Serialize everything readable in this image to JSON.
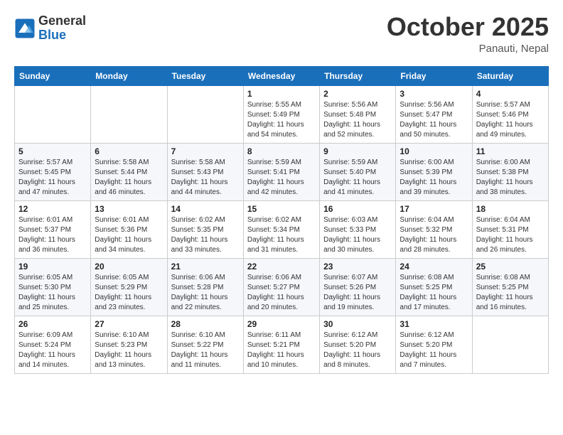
{
  "header": {
    "logo_general": "General",
    "logo_blue": "Blue",
    "title": "October 2025",
    "subtitle": "Panauti, Nepal"
  },
  "weekdays": [
    "Sunday",
    "Monday",
    "Tuesday",
    "Wednesday",
    "Thursday",
    "Friday",
    "Saturday"
  ],
  "weeks": [
    [
      {
        "day": "",
        "info": ""
      },
      {
        "day": "",
        "info": ""
      },
      {
        "day": "",
        "info": ""
      },
      {
        "day": "1",
        "info": "Sunrise: 5:55 AM\nSunset: 5:49 PM\nDaylight: 11 hours\nand 54 minutes."
      },
      {
        "day": "2",
        "info": "Sunrise: 5:56 AM\nSunset: 5:48 PM\nDaylight: 11 hours\nand 52 minutes."
      },
      {
        "day": "3",
        "info": "Sunrise: 5:56 AM\nSunset: 5:47 PM\nDaylight: 11 hours\nand 50 minutes."
      },
      {
        "day": "4",
        "info": "Sunrise: 5:57 AM\nSunset: 5:46 PM\nDaylight: 11 hours\nand 49 minutes."
      }
    ],
    [
      {
        "day": "5",
        "info": "Sunrise: 5:57 AM\nSunset: 5:45 PM\nDaylight: 11 hours\nand 47 minutes."
      },
      {
        "day": "6",
        "info": "Sunrise: 5:58 AM\nSunset: 5:44 PM\nDaylight: 11 hours\nand 46 minutes."
      },
      {
        "day": "7",
        "info": "Sunrise: 5:58 AM\nSunset: 5:43 PM\nDaylight: 11 hours\nand 44 minutes."
      },
      {
        "day": "8",
        "info": "Sunrise: 5:59 AM\nSunset: 5:41 PM\nDaylight: 11 hours\nand 42 minutes."
      },
      {
        "day": "9",
        "info": "Sunrise: 5:59 AM\nSunset: 5:40 PM\nDaylight: 11 hours\nand 41 minutes."
      },
      {
        "day": "10",
        "info": "Sunrise: 6:00 AM\nSunset: 5:39 PM\nDaylight: 11 hours\nand 39 minutes."
      },
      {
        "day": "11",
        "info": "Sunrise: 6:00 AM\nSunset: 5:38 PM\nDaylight: 11 hours\nand 38 minutes."
      }
    ],
    [
      {
        "day": "12",
        "info": "Sunrise: 6:01 AM\nSunset: 5:37 PM\nDaylight: 11 hours\nand 36 minutes."
      },
      {
        "day": "13",
        "info": "Sunrise: 6:01 AM\nSunset: 5:36 PM\nDaylight: 11 hours\nand 34 minutes."
      },
      {
        "day": "14",
        "info": "Sunrise: 6:02 AM\nSunset: 5:35 PM\nDaylight: 11 hours\nand 33 minutes."
      },
      {
        "day": "15",
        "info": "Sunrise: 6:02 AM\nSunset: 5:34 PM\nDaylight: 11 hours\nand 31 minutes."
      },
      {
        "day": "16",
        "info": "Sunrise: 6:03 AM\nSunset: 5:33 PM\nDaylight: 11 hours\nand 30 minutes."
      },
      {
        "day": "17",
        "info": "Sunrise: 6:04 AM\nSunset: 5:32 PM\nDaylight: 11 hours\nand 28 minutes."
      },
      {
        "day": "18",
        "info": "Sunrise: 6:04 AM\nSunset: 5:31 PM\nDaylight: 11 hours\nand 26 minutes."
      }
    ],
    [
      {
        "day": "19",
        "info": "Sunrise: 6:05 AM\nSunset: 5:30 PM\nDaylight: 11 hours\nand 25 minutes."
      },
      {
        "day": "20",
        "info": "Sunrise: 6:05 AM\nSunset: 5:29 PM\nDaylight: 11 hours\nand 23 minutes."
      },
      {
        "day": "21",
        "info": "Sunrise: 6:06 AM\nSunset: 5:28 PM\nDaylight: 11 hours\nand 22 minutes."
      },
      {
        "day": "22",
        "info": "Sunrise: 6:06 AM\nSunset: 5:27 PM\nDaylight: 11 hours\nand 20 minutes."
      },
      {
        "day": "23",
        "info": "Sunrise: 6:07 AM\nSunset: 5:26 PM\nDaylight: 11 hours\nand 19 minutes."
      },
      {
        "day": "24",
        "info": "Sunrise: 6:08 AM\nSunset: 5:25 PM\nDaylight: 11 hours\nand 17 minutes."
      },
      {
        "day": "25",
        "info": "Sunrise: 6:08 AM\nSunset: 5:25 PM\nDaylight: 11 hours\nand 16 minutes."
      }
    ],
    [
      {
        "day": "26",
        "info": "Sunrise: 6:09 AM\nSunset: 5:24 PM\nDaylight: 11 hours\nand 14 minutes."
      },
      {
        "day": "27",
        "info": "Sunrise: 6:10 AM\nSunset: 5:23 PM\nDaylight: 11 hours\nand 13 minutes."
      },
      {
        "day": "28",
        "info": "Sunrise: 6:10 AM\nSunset: 5:22 PM\nDaylight: 11 hours\nand 11 minutes."
      },
      {
        "day": "29",
        "info": "Sunrise: 6:11 AM\nSunset: 5:21 PM\nDaylight: 11 hours\nand 10 minutes."
      },
      {
        "day": "30",
        "info": "Sunrise: 6:12 AM\nSunset: 5:20 PM\nDaylight: 11 hours\nand 8 minutes."
      },
      {
        "day": "31",
        "info": "Sunrise: 6:12 AM\nSunset: 5:20 PM\nDaylight: 11 hours\nand 7 minutes."
      },
      {
        "day": "",
        "info": ""
      }
    ]
  ]
}
